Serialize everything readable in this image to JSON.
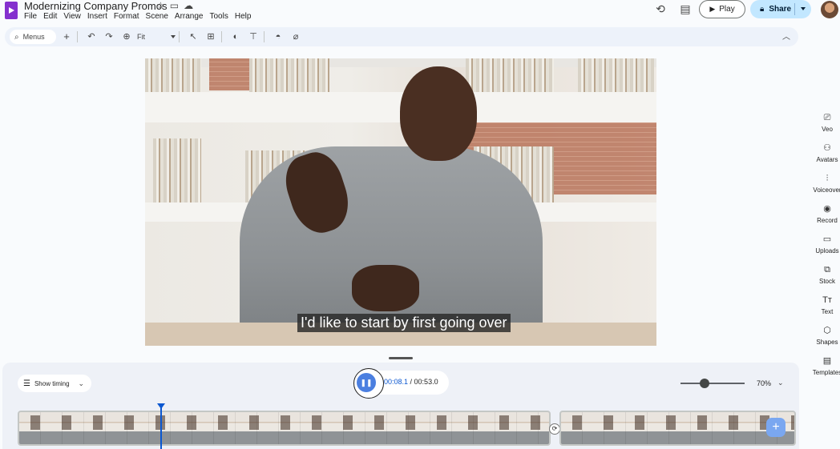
{
  "header": {
    "title": "Modernizing Company Promos",
    "menu": [
      "File",
      "Edit",
      "View",
      "Insert",
      "Format",
      "Scene",
      "Arrange",
      "Tools",
      "Help"
    ],
    "play_label": "Play",
    "share_label": "Share"
  },
  "toolbar": {
    "menus_label": "Menus",
    "zoom_value": "Fit"
  },
  "canvas": {
    "caption": "I'd like to start by first going over"
  },
  "side_panel": {
    "items": [
      {
        "label": "Veo",
        "icon": "veo-icon"
      },
      {
        "label": "Avatars",
        "icon": "avatars-icon"
      },
      {
        "label": "Voiceover",
        "icon": "voiceover-icon"
      },
      {
        "label": "Record",
        "icon": "record-icon"
      },
      {
        "label": "Uploads",
        "icon": "uploads-icon"
      },
      {
        "label": "Stock",
        "icon": "stock-icon"
      },
      {
        "label": "Text",
        "icon": "text-icon"
      },
      {
        "label": "Shapes",
        "icon": "shapes-icon"
      },
      {
        "label": "Templates",
        "icon": "templates-icon"
      }
    ]
  },
  "timeline": {
    "show_timing_label": "Show timing",
    "current_time": "00:08.1",
    "time_separator": " / ",
    "total_time": "00:53.0",
    "zoom_percent": "70%",
    "zoom_level": 0.38
  },
  "colors": {
    "accent": "#0b57d0",
    "share_bg": "#c2e7ff",
    "brand": "#8430ce"
  }
}
